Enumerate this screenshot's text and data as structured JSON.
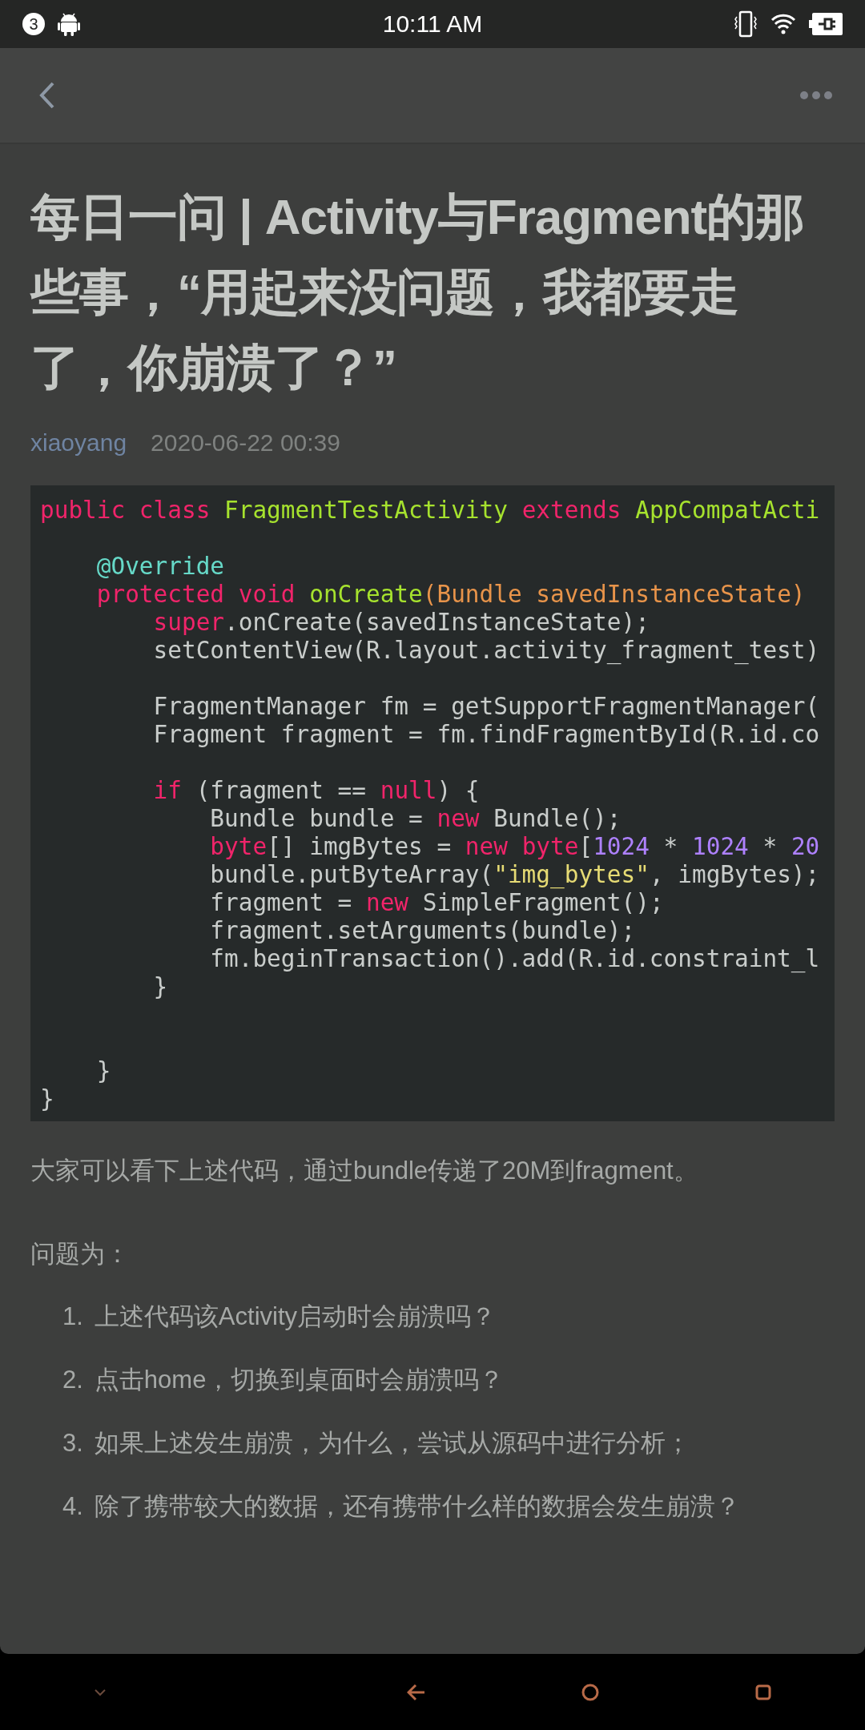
{
  "status_bar": {
    "notification_count": "3",
    "time": "10:11 AM"
  },
  "article": {
    "title": "每日一问 | Activity与Fragment的那些事，“用起来没问题，我都要走了，你崩溃了？”",
    "author": "xiaoyang",
    "date": "2020-06-22 00:39",
    "code_lines": [
      {
        "kind": "code",
        "tokens": [
          {
            "kind": "kw",
            "text": "public class "
          },
          {
            "kind": "cls",
            "text": "FragmentTestActivity "
          },
          {
            "kind": "kw",
            "text": "extends "
          },
          {
            "kind": "cls",
            "text": "AppCompatActi"
          }
        ]
      },
      {
        "kind": "blank"
      },
      {
        "kind": "code",
        "tokens": [
          {
            "kind": "ann",
            "text": "    @Override"
          }
        ]
      },
      {
        "kind": "code",
        "tokens": [
          {
            "kind": "kw",
            "text": "    protected void "
          },
          {
            "kind": "cls",
            "text": "onCreate"
          },
          {
            "kind": "param",
            "text": "(Bundle savedInstanceState)"
          }
        ]
      },
      {
        "kind": "code",
        "tokens": [
          {
            "kind": "kw",
            "text": "        super"
          },
          {
            "kind": "plain",
            "text": ".onCreate(savedInstanceState);"
          }
        ]
      },
      {
        "kind": "code",
        "tokens": [
          {
            "kind": "plain",
            "text": "        setContentView(R.layout.activity_fragment_test)"
          }
        ]
      },
      {
        "kind": "blank"
      },
      {
        "kind": "code",
        "tokens": [
          {
            "kind": "plain",
            "text": "        FragmentManager fm = getSupportFragmentManager("
          }
        ]
      },
      {
        "kind": "code",
        "tokens": [
          {
            "kind": "plain",
            "text": "        Fragment fragment = fm.findFragmentById(R.id.co"
          }
        ]
      },
      {
        "kind": "blank"
      },
      {
        "kind": "code",
        "tokens": [
          {
            "kind": "kw",
            "text": "        if"
          },
          {
            "kind": "plain",
            "text": " (fragment == "
          },
          {
            "kind": "kw",
            "text": "null"
          },
          {
            "kind": "plain",
            "text": ") {"
          }
        ]
      },
      {
        "kind": "code",
        "tokens": [
          {
            "kind": "plain",
            "text": "            Bundle bundle = "
          },
          {
            "kind": "kw",
            "text": "new"
          },
          {
            "kind": "plain",
            "text": " Bundle();"
          }
        ]
      },
      {
        "kind": "code",
        "tokens": [
          {
            "kind": "kw",
            "text": "            byte"
          },
          {
            "kind": "plain",
            "text": "[] imgBytes = "
          },
          {
            "kind": "kw",
            "text": "new byte"
          },
          {
            "kind": "plain",
            "text": "["
          },
          {
            "kind": "num",
            "text": "1024"
          },
          {
            "kind": "plain",
            "text": " * "
          },
          {
            "kind": "num",
            "text": "1024"
          },
          {
            "kind": "plain",
            "text": " * "
          },
          {
            "kind": "num",
            "text": "20"
          }
        ]
      },
      {
        "kind": "code",
        "tokens": [
          {
            "kind": "plain",
            "text": "            bundle.putByteArray("
          },
          {
            "kind": "str",
            "text": "\"img_bytes\""
          },
          {
            "kind": "plain",
            "text": ", imgBytes);"
          }
        ]
      },
      {
        "kind": "code",
        "tokens": [
          {
            "kind": "plain",
            "text": "            fragment = "
          },
          {
            "kind": "kw",
            "text": "new"
          },
          {
            "kind": "plain",
            "text": " SimpleFragment();"
          }
        ]
      },
      {
        "kind": "code",
        "tokens": [
          {
            "kind": "plain",
            "text": "            fragment.setArguments(bundle);"
          }
        ]
      },
      {
        "kind": "code",
        "tokens": [
          {
            "kind": "plain",
            "text": "            fm.beginTransaction().add(R.id.constraint_l"
          }
        ]
      },
      {
        "kind": "code",
        "tokens": [
          {
            "kind": "plain",
            "text": "        }"
          }
        ]
      },
      {
        "kind": "blank"
      },
      {
        "kind": "blank"
      },
      {
        "kind": "code",
        "tokens": [
          {
            "kind": "plain",
            "text": "    }"
          }
        ]
      },
      {
        "kind": "code",
        "tokens": [
          {
            "kind": "plain",
            "text": "}"
          }
        ]
      }
    ],
    "paragraphs": [
      "大家可以看下上述代码，通过bundle传递了20M到fragment。",
      "问题为："
    ],
    "questions": [
      {
        "number": "1.",
        "text": "上述代码该Activity启动时会崩溃吗？"
      },
      {
        "number": "2.",
        "text": "点击home，切换到桌面时会崩溃吗？"
      },
      {
        "number": "3.",
        "text": "如果上述发生崩溃，为什么，尝试从源码中进行分析；"
      },
      {
        "number": "4.",
        "text": "除了携带较大的数据，还有携带什么样的数据会发生崩溃？"
      }
    ]
  }
}
